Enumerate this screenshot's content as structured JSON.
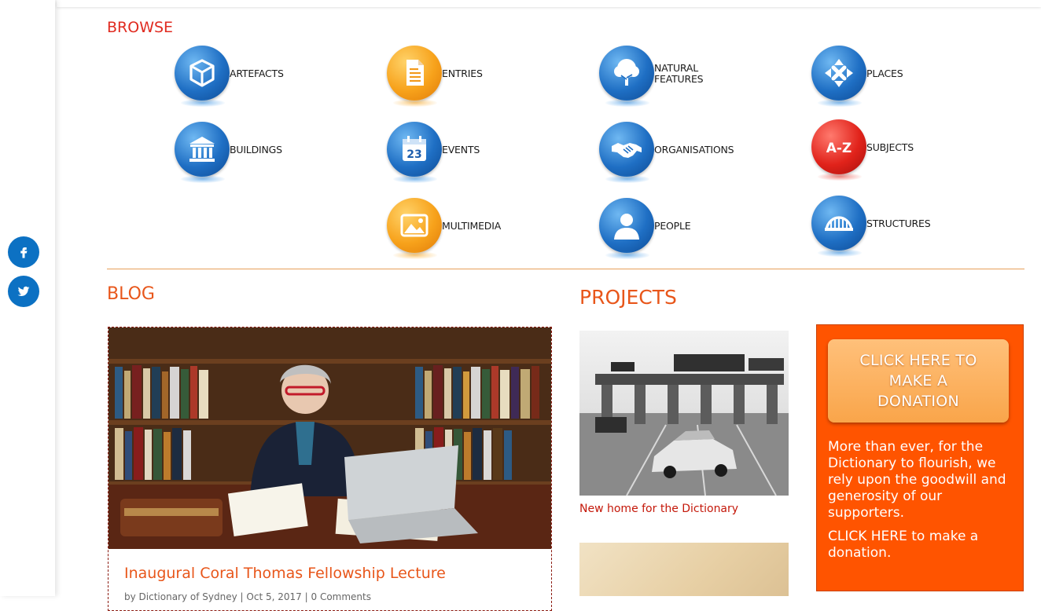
{
  "header": {
    "browse_title": "BROWSE",
    "blog_title": "BLOG",
    "projects_title": "PROJECTS"
  },
  "share": {
    "facebook_icon": "facebook-icon",
    "twitter_icon": "twitter-icon"
  },
  "browse": {
    "tiles": [
      {
        "label": "ARTEFACTS",
        "icon": "cube-icon",
        "color": "blue"
      },
      {
        "label": "ENTRIES",
        "icon": "document-icon",
        "color": "orange"
      },
      {
        "label": "NATURAL\nFEATURES",
        "icon": "tree-icon",
        "color": "blue"
      },
      {
        "label": "PLACES",
        "icon": "map-cross-icon",
        "color": "blue"
      },
      {
        "label": "BUILDINGS",
        "icon": "building-columns-icon",
        "color": "blue"
      },
      {
        "label": "EVENTS",
        "icon": "calendar-icon",
        "color": "blue"
      },
      {
        "label": "ORGANISATIONS",
        "icon": "handshake-icon",
        "color": "blue"
      },
      {
        "label": "SUBJECTS",
        "icon": "a-z-icon",
        "color": "red",
        "badge": "A-Z"
      },
      {
        "label": "MULTIMEDIA",
        "icon": "image-icon",
        "color": "orange"
      },
      {
        "label": "PEOPLE",
        "icon": "person-icon",
        "color": "blue"
      },
      {
        "label": "STRUCTURES",
        "icon": "bridge-icon",
        "color": "blue"
      }
    ],
    "calendar_day": "23"
  },
  "blog": {
    "post_title": "Inaugural Coral Thomas Fellowship Lecture",
    "author_prefix": "by",
    "author": "Dictionary of Sydney",
    "separator": "|",
    "date": "Oct 5, 2017",
    "comments": "0 Comments"
  },
  "projects": {
    "item1_link": "New home for the Dictionary"
  },
  "donate": {
    "button_label": "CLICK HERE TO\nMAKE A\nDONATION",
    "body_text": "More than ever, for the Dictionary to flourish, we rely upon the goodwill and generosity of our supporters.",
    "link_text": "CLICK HERE to make a donation."
  },
  "colors": {
    "accent_orange": "#e8561a",
    "donate_bg": "#ff5400",
    "share_blue": "#0c71c3",
    "link_red": "#c4180a"
  }
}
